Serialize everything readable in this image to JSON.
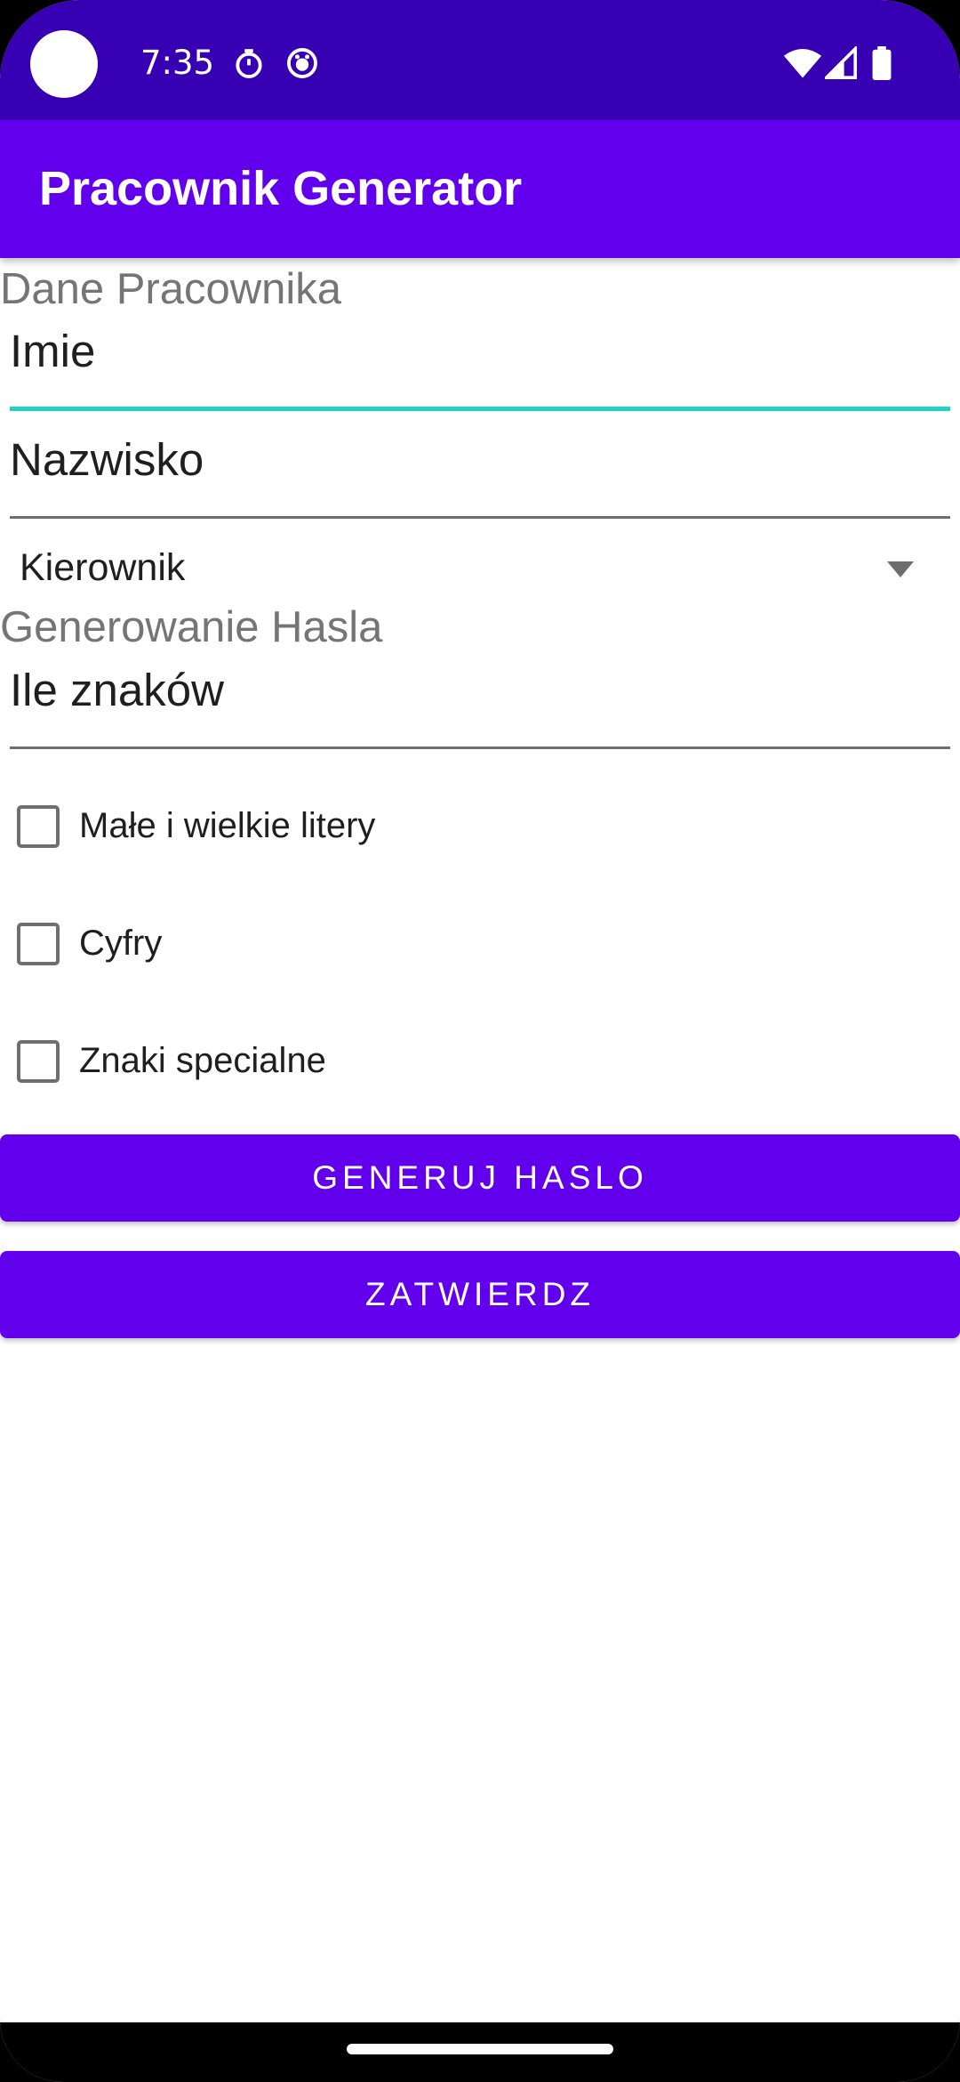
{
  "status_bar": {
    "time": "7:35",
    "icons": [
      "camera-hole",
      "timer-icon",
      "assistant-icon",
      "wifi-icon",
      "signal-icon",
      "battery-icon"
    ]
  },
  "app_bar": {
    "title": "Pracownik Generator"
  },
  "employee_section": {
    "heading": "Dane Pracownika",
    "first_name_placeholder": "Imie",
    "last_name_placeholder": "Nazwisko",
    "position_selected": "Kierownik"
  },
  "password_section": {
    "heading": "Generowanie Hasla",
    "length_placeholder": "Ile znaków",
    "options": [
      {
        "label": "Małe i wielkie litery",
        "checked": false
      },
      {
        "label": "Cyfry",
        "checked": false
      },
      {
        "label": "Znaki specialne",
        "checked": false
      }
    ]
  },
  "buttons": {
    "generate_label": "GENERUJ HASLO",
    "submit_label": "ZATWIERDZ"
  },
  "colors": {
    "status_bar": "#3700b3",
    "primary": "#6200ee",
    "accent": "#1fd3c7",
    "text": "#1f1f1f",
    "heading_text": "#757575"
  }
}
